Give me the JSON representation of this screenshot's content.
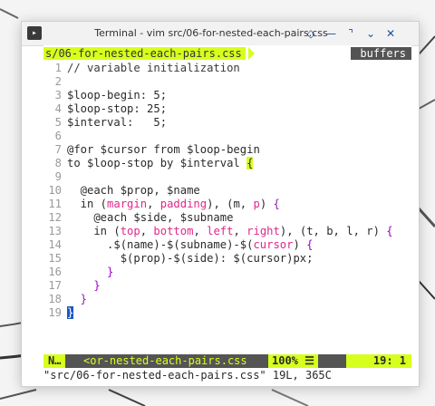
{
  "window": {
    "title": "Terminal - vim src/06-for-nested-each-pairs.css",
    "icons": [
      "terminal-icon",
      "sticky-icon",
      "minimize-icon",
      "maximize-icon",
      "expand-icon",
      "close-icon"
    ],
    "button_glyphs": {
      "sticky": "◇",
      "minimize": "—",
      "maximize": "⌝",
      "expand": "⌄",
      "close": "✕"
    }
  },
  "tabline": {
    "current": "s/06-for-nested-each-pairs.css",
    "buffers_label": "buffers"
  },
  "code": {
    "line_numbers": [
      "1",
      "2",
      "3",
      "4",
      "5",
      "6",
      "7",
      "8",
      "9",
      "10",
      "11",
      "12",
      "13",
      "14",
      "15",
      "16",
      "17",
      "18",
      "19"
    ]
  },
  "statusline": {
    "mode": "N…",
    "file": "<or-nested-each-pairs.css",
    "percent": "100% ☰",
    "position": "19:  1"
  },
  "cmdline": {
    "message": "\"src/06-for-nested-each-pairs.css\" 19L, 365C"
  },
  "colors": {
    "accent": "#d7ff1d",
    "statusline_bg": "#545454",
    "purple": "#a000c8",
    "pink": "#e0278a",
    "cursor": "#1a57c2"
  }
}
